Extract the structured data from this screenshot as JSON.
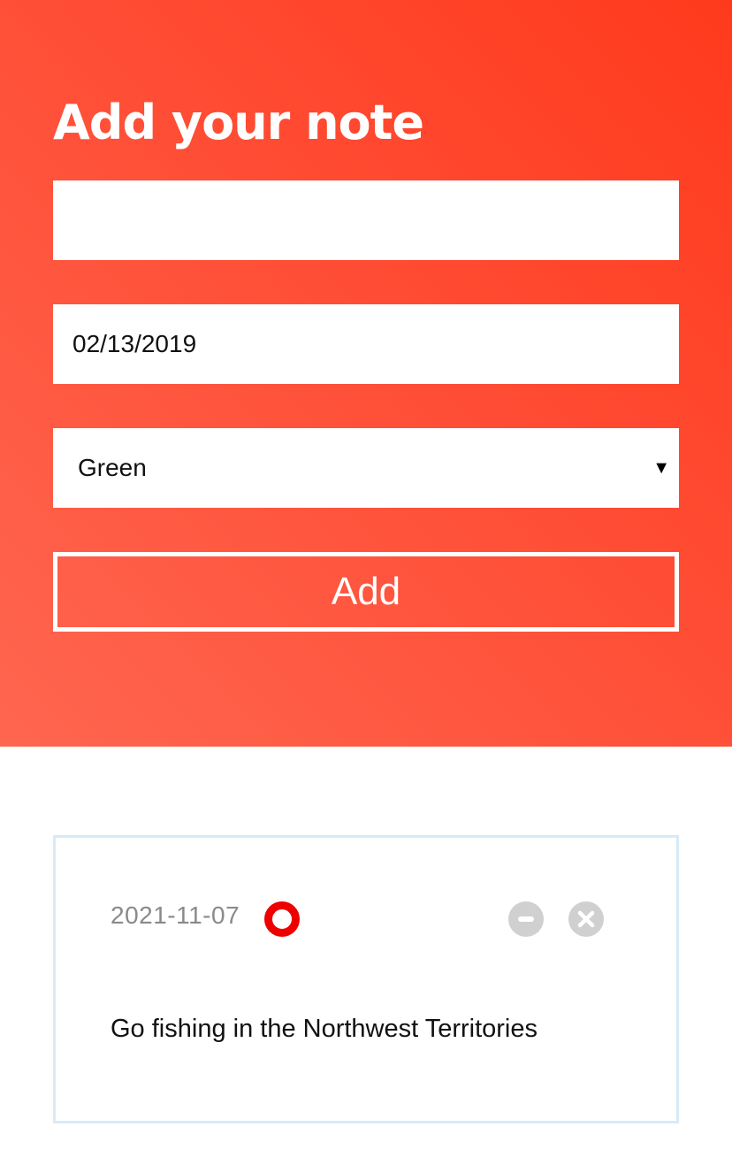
{
  "form": {
    "title": "Add your note",
    "note_value": "",
    "date_value": "02/13/2019",
    "color_selected": "Green",
    "add_label": "Add"
  },
  "notes": [
    {
      "date": "2021-11-07",
      "text": "Go fishing in the Northwest Territories",
      "status_color": "#ee0000"
    }
  ],
  "colors": {
    "hero_gradient_start": "#ff3a1c",
    "hero_gradient_end": "#ff6650",
    "card_border": "#d6ebf7",
    "icon_gray": "#d0d0d0"
  },
  "icons": {
    "select": "dropdown-arrow-icon",
    "status": "status-ring-icon",
    "minus": "minus-circle-icon",
    "close": "close-circle-icon"
  }
}
